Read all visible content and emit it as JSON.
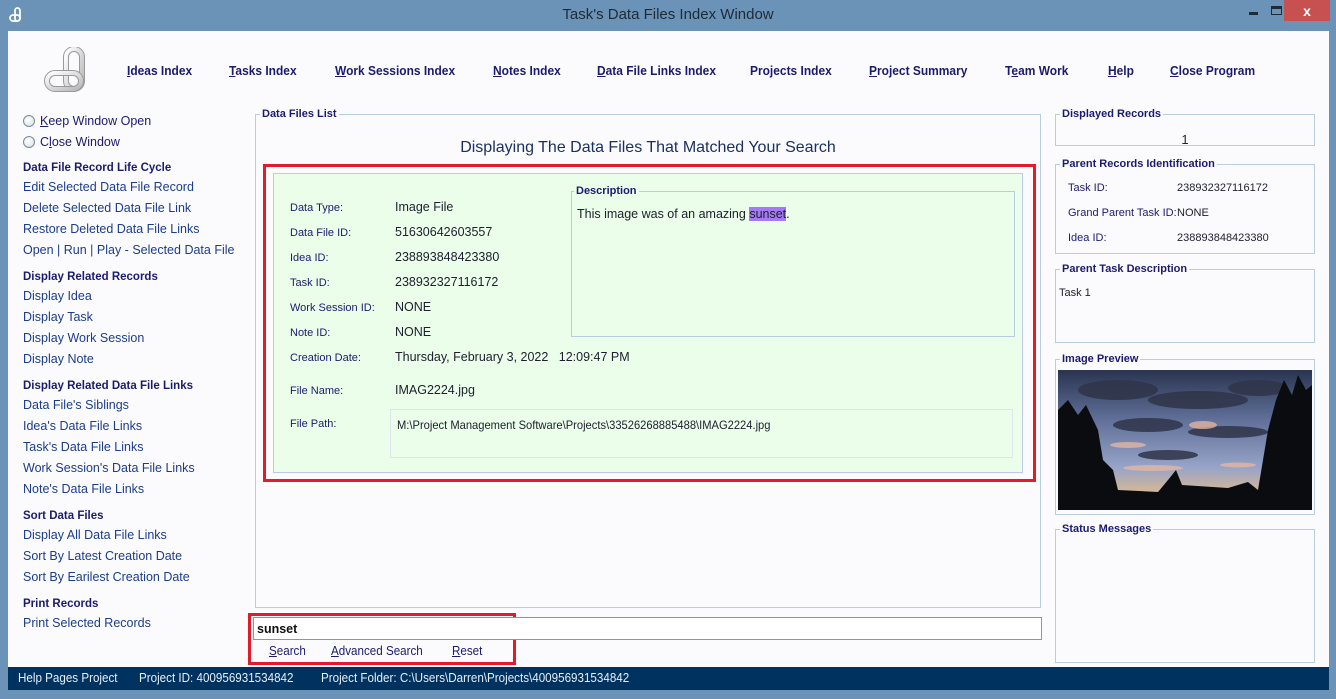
{
  "window": {
    "title": "Task's Data Files Index Window",
    "close_glyph": "x",
    "icon": "link-chain-icon"
  },
  "topnav": {
    "items": [
      {
        "label": "Ideas Index",
        "accel": "I"
      },
      {
        "label": "Tasks Index",
        "accel": "T"
      },
      {
        "label": "Work Sessions Index",
        "accel": "W"
      },
      {
        "label": "Notes Index",
        "accel": "N"
      },
      {
        "label": "Data File Links Index",
        "accel": "D"
      },
      {
        "label": "Projects Index",
        "accel": ""
      },
      {
        "label": "Project Summary",
        "accel": "P"
      },
      {
        "label": "Team Work",
        "accel": "e"
      },
      {
        "label": "Help",
        "accel": "H"
      },
      {
        "label": "Close Program",
        "accel": "C"
      }
    ]
  },
  "sidebar": {
    "radios": [
      {
        "label": "Keep Window Open",
        "selected": false
      },
      {
        "label": "Close Window",
        "selected": false
      }
    ],
    "sections": [
      {
        "heading": "Data File Record Life Cycle",
        "links": [
          "Edit Selected Data File Record",
          "Delete Selected Data File Link",
          "Restore Deleted Data File Links",
          "Open | Run | Play - Selected Data File"
        ]
      },
      {
        "heading": "Display Related Records",
        "links": [
          "Display Idea",
          "Display Task",
          "Display Work Session",
          "Display Note"
        ]
      },
      {
        "heading": "Display Related Data File Links",
        "links": [
          "Data File's Siblings",
          "Idea's Data File Links",
          "Task's Data File Links",
          "Work Session's Data File Links",
          "Note's Data File Links"
        ]
      },
      {
        "heading": "Sort Data Files",
        "links": [
          "Display All Data File Links",
          "Sort By Latest Creation Date",
          "Sort By Earilest Creation Date"
        ]
      },
      {
        "heading": "Print Records",
        "links": [
          "Print Selected Records"
        ]
      }
    ]
  },
  "data_files_list": {
    "legend": "Data Files List",
    "heading": "Displaying The Data Files That Matched Your Search",
    "record": {
      "fields": [
        {
          "label": "Data Type:",
          "value": "Image File"
        },
        {
          "label": "Data File ID:",
          "value": "51630642603557"
        },
        {
          "label": "Idea ID:",
          "value": "238893848423380"
        },
        {
          "label": "Task ID:",
          "value": "238932327116172"
        },
        {
          "label": "Work Session ID:",
          "value": "NONE"
        },
        {
          "label": "Note ID:",
          "value": "NONE"
        },
        {
          "label": "Creation Date:",
          "value": "Thursday, February 3, 2022   12:09:47 PM"
        },
        {
          "label": "File Name:",
          "value": "IMAG2224.jpg"
        },
        {
          "label": "File Path:",
          "value": "M:\\Project Management Software\\Projects\\33526268885488\\IMAG2224.jpg"
        }
      ],
      "description": {
        "legend": "Description",
        "text_before": "This image was of an amazing ",
        "highlight": "sunset",
        "text_after": "."
      }
    }
  },
  "search": {
    "value": "sunset",
    "placeholder": "",
    "buttons": [
      {
        "label": "Search",
        "accel": "S"
      },
      {
        "label": "Advanced Search",
        "accel": "A"
      },
      {
        "label": "Reset",
        "accel": "R"
      }
    ]
  },
  "right_panel": {
    "displayed_records": {
      "legend": "Displayed Records",
      "value": "1"
    },
    "parent_records": {
      "legend": "Parent Records Identification",
      "rows": [
        {
          "label": "Task ID:",
          "value": "238932327116172"
        },
        {
          "label": "Grand Parent Task ID:",
          "value": "NONE"
        },
        {
          "label": "Idea ID:",
          "value": "238893848423380"
        }
      ]
    },
    "parent_task_description": {
      "legend": "Parent Task Description",
      "text": "Task 1"
    },
    "image_preview": {
      "legend": "Image Preview",
      "subject": "sunset sky with tree silhouettes"
    },
    "status_messages": {
      "legend": "Status Messages",
      "text": ""
    }
  },
  "statusbar": {
    "project_name": "Help Pages Project",
    "project_id": "Project ID:  400956931534842",
    "project_folder": "Project Folder: C:\\Users\\Darren\\Projects\\400956931534842"
  },
  "colors": {
    "title_bar": "#6b93b8",
    "close_button": "#c75050",
    "status_bar": "#00325f",
    "highlight_box": "#e21b2a",
    "record_background": "#eafeea",
    "search_highlight": "#a57bf5",
    "link_text": "#1b1b6e"
  }
}
